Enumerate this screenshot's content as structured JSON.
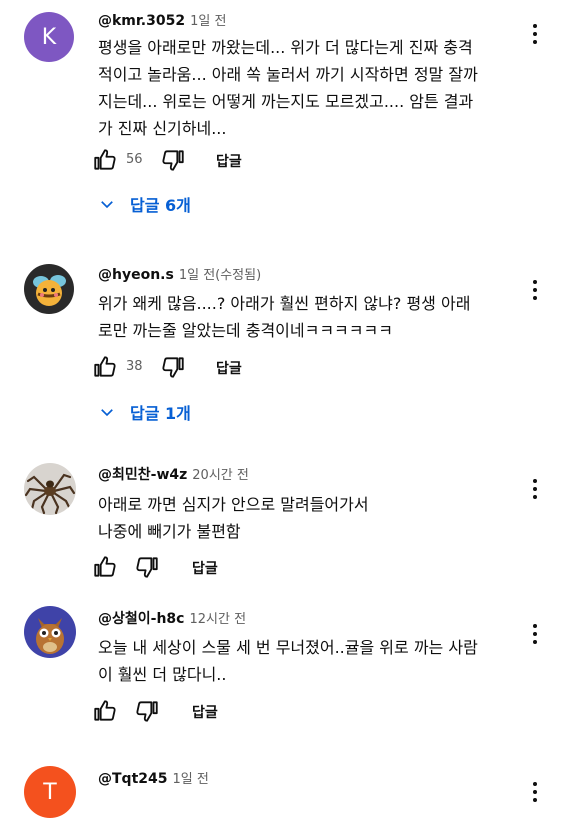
{
  "comments": [
    {
      "avatar_letter": "K",
      "avatar_color": "#7e57c2",
      "handle": "@kmr.3052",
      "meta": "1일 전",
      "text": "평생을 아래로만 까왔는데... 위가 더 많다는게 진짜 충격\n적이고 놀라움... 아래 쏙 눌러서 까기 시작하면 정말 잘까\n지는데... 위로는 어떻게 까는지도 모르겠고.... 암튼 결과\n가 진짜 신기하네...",
      "likes": "56",
      "reply_label": "답글",
      "replies_label": "답글 6개"
    },
    {
      "avatar_icon": "bee-avatar",
      "handle": "@hyeon.s",
      "meta": "1일 전(수정됨)",
      "text": "위가 왜케 많음....? 아래가 훨씬 편하지 않냐? 평생 아래\n로만 까는줄 알았는데 충격이네ㅋㅋㅋㅋㅋㅋ",
      "likes": "38",
      "reply_label": "답글",
      "replies_label": "답글 1개"
    },
    {
      "avatar_icon": "spider-avatar",
      "handle": "@최민찬-w4z",
      "meta": "20시간 전",
      "text": "아래로 까면 심지가 안으로 말려들어가서\n나중에 빼기가 불편함",
      "reply_label": "답글"
    },
    {
      "avatar_icon": "owl-avatar",
      "handle": "@상철이-h8c",
      "meta": "12시간 전",
      "text": "오늘 내 세상이 스물 세 번 무너졌어..귤을 위로 까는 사람\n이 훨씬 더 많다니..",
      "reply_label": "답글"
    },
    {
      "avatar_letter": "T",
      "avatar_color": "#f4511e",
      "handle": "@Tqt245",
      "meta": "1일 전"
    }
  ],
  "colors": {
    "link_blue": "#065fd4",
    "meta_gray": "#606060"
  },
  "icons": [
    "thumb-up-icon",
    "thumb-down-icon",
    "chevron-down-icon",
    "more-vert-icon"
  ]
}
